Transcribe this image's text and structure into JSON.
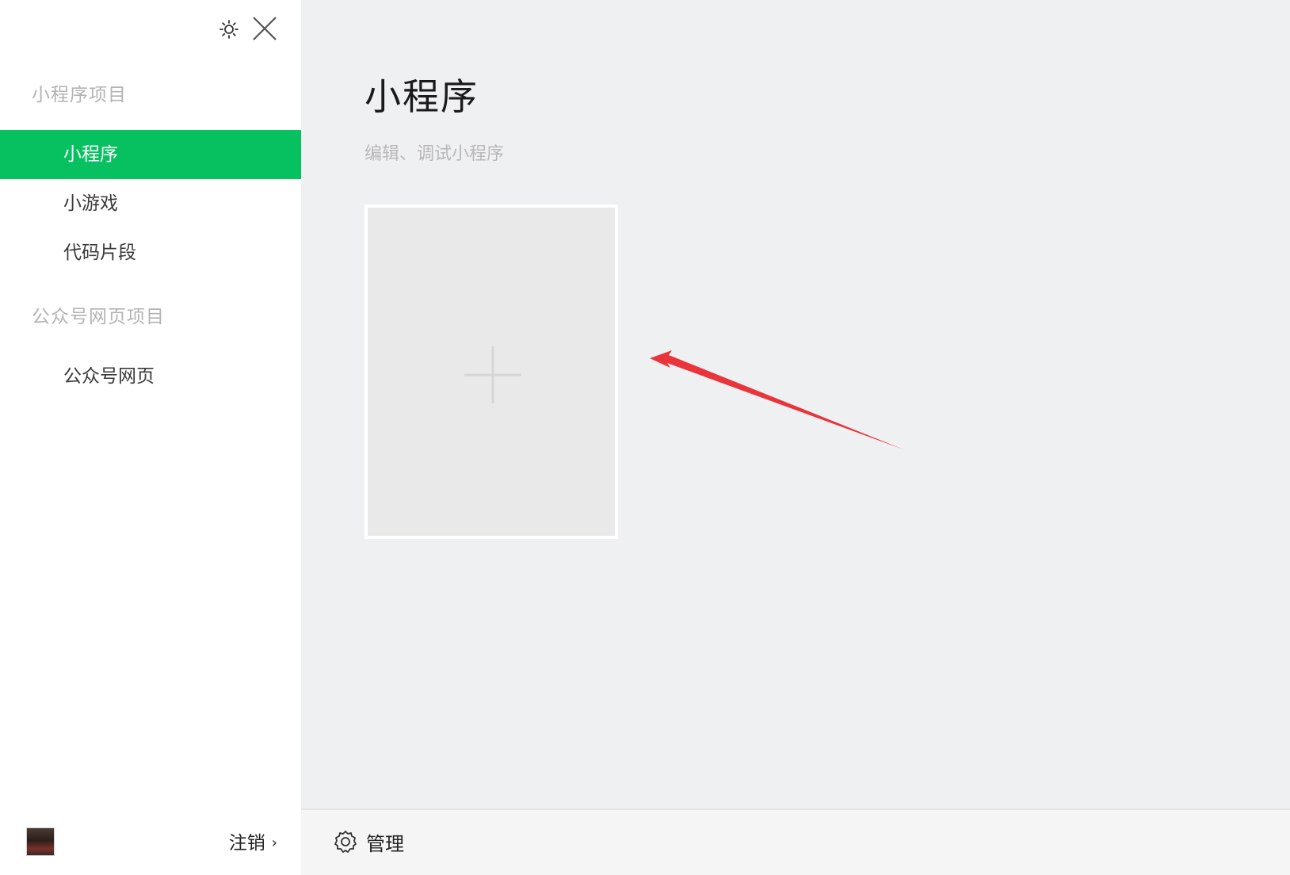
{
  "sidebar": {
    "sections": [
      {
        "title": "小程序项目",
        "items": [
          "小程序",
          "小游戏",
          "代码片段"
        ]
      },
      {
        "title": "公众号网页项目",
        "items": [
          "公众号网页"
        ]
      }
    ],
    "active_item": "小程序",
    "logout_label": "注销",
    "logout_chevron": "›"
  },
  "main": {
    "title": "小程序",
    "subtitle": "编辑、调试小程序"
  },
  "bottombar": {
    "manage_label": "管理"
  },
  "colors": {
    "accent": "#07c160",
    "annotation_arrow": "#e8343a"
  },
  "icons": [
    "sun-icon",
    "close-icon",
    "plus-icon",
    "gear-icon",
    "chevron-right-icon",
    "arrow-annotation"
  ]
}
